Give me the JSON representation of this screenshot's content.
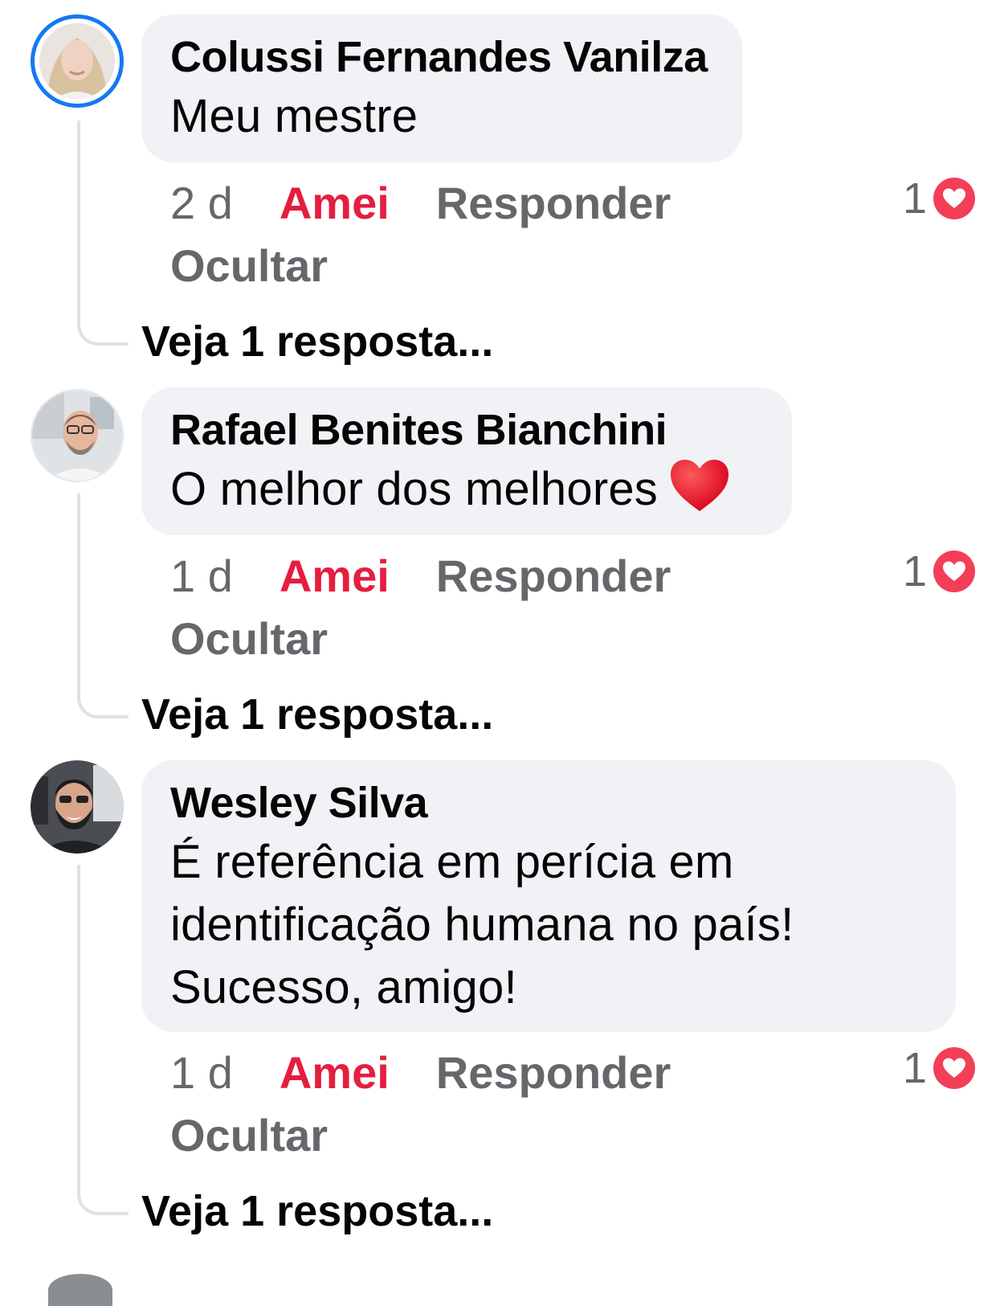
{
  "comments": [
    {
      "author": "Colussi Fernandes Vanilza",
      "text": "Meu mestre",
      "time": "2 d",
      "like_label": "Amei",
      "reply_label": "Responder",
      "hide_label": "Ocultar",
      "reaction_count": "1",
      "replies_link": "Veja 1 resposta...",
      "avatar": "profile-photo-woman",
      "has_story_ring": true
    },
    {
      "author": "Rafael Benites Bianchini",
      "text": "O melhor dos melhores",
      "emoji": "red-heart-emoji",
      "time": "1 d",
      "like_label": "Amei",
      "reply_label": "Responder",
      "hide_label": "Ocultar",
      "reaction_count": "1",
      "replies_link": "Veja 1 resposta...",
      "avatar": "profile-photo-man-glasses"
    },
    {
      "author": "Wesley Silva",
      "text_lines": [
        "É referência em perícia em",
        "identificação humana no país!",
        "Sucesso, amigo!"
      ],
      "time": "1 d",
      "like_label": "Amei",
      "reply_label": "Responder",
      "hide_label": "Ocultar",
      "reaction_count": "1",
      "replies_link": "Veja 1 resposta...",
      "avatar": "profile-photo-man-beard"
    }
  ],
  "colors": {
    "love_red": "#e41e3f",
    "reaction_heart": "#f33e58",
    "bubble_bg": "#f0f2f5",
    "secondary_text": "#65676b",
    "story_ring": "#1877f2"
  }
}
